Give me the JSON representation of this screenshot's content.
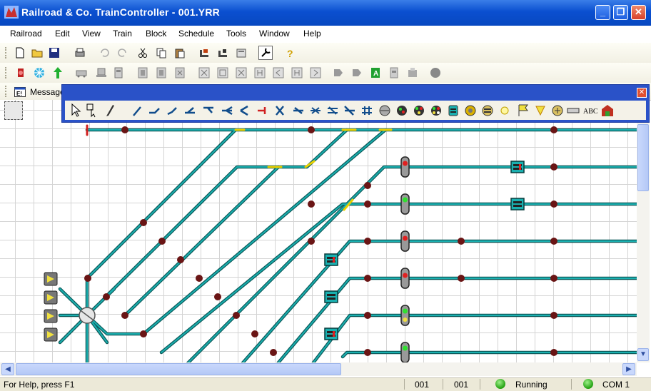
{
  "window": {
    "title": "Railroad & Co. TrainController - 001.YRR"
  },
  "menu": [
    "Railroad",
    "Edit",
    "View",
    "Train",
    "Block",
    "Schedule",
    "Tools",
    "Window",
    "Help"
  ],
  "message_tab": {
    "label": "Message"
  },
  "palette": {
    "abc_label": "ABC"
  },
  "statusbar": {
    "help": "For Help, press F1",
    "field1": "001",
    "field2": "001",
    "state": "Running",
    "port": "COM 1"
  },
  "colors": {
    "track": "#1a9e9e",
    "track_outline": "#0c5a5a",
    "contact": "#6e1a1a",
    "titlebar": "#0a4fd0",
    "palette": "#2a52c8"
  },
  "toolbar_icons": {
    "row1": [
      "new-icon",
      "open-icon",
      "save-icon",
      "print-icon",
      "undo-icon",
      "redo-icon",
      "cut-icon",
      "copy-icon",
      "paste-icon",
      "train-window-icon",
      "switchboard-icon",
      "properties-icon",
      "wrench-icon",
      "help-icon"
    ],
    "row2": [
      "emergency-stop-icon",
      "halt-icon",
      "go-icon",
      "locomotive-icon",
      "train-icon",
      "block-icon",
      "contact-icon",
      "lock-icon",
      "release-icon",
      "route-icon",
      "signal-icon",
      "turnout-icon",
      "flag-icon",
      "stop-all-icon"
    ]
  }
}
